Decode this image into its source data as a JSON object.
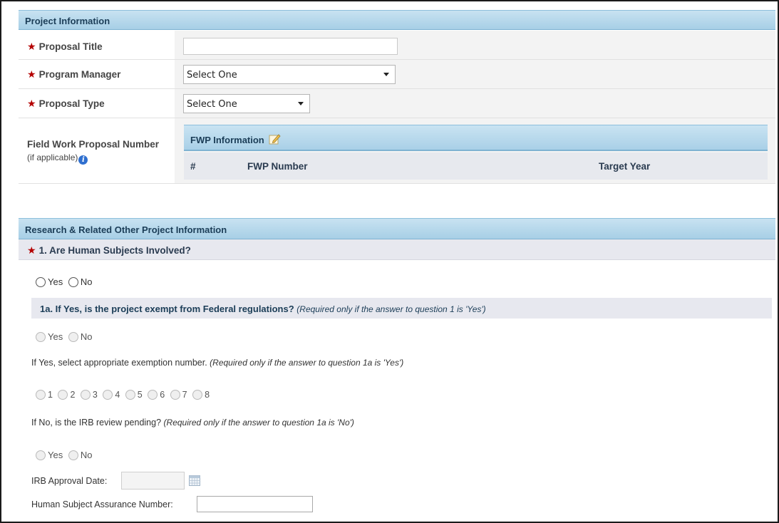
{
  "project_info": {
    "header": "Project Information",
    "proposal_title": {
      "label": "Proposal Title",
      "value": ""
    },
    "program_manager": {
      "label": "Program Manager",
      "selected": "Select One"
    },
    "proposal_type": {
      "label": "Proposal Type",
      "selected": "Select One"
    },
    "fwp": {
      "label": "Field Work Proposal Number",
      "sublabel": "(if applicable)",
      "info_icon": "info-icon",
      "table_header": "FWP Information",
      "edit_icon": "pencil-icon",
      "columns": [
        "#",
        "FWP Number",
        "Target Year"
      ]
    }
  },
  "rr_other": {
    "header": "Research & Related Other Project Information",
    "q1": {
      "label": "1. Are Human Subjects Involved?",
      "options": [
        "Yes",
        "No"
      ]
    },
    "q1a": {
      "label": "1a. If Yes, is the project exempt from Federal regulations?",
      "hint": "(Required only if the answer to question 1 is 'Yes')",
      "options": [
        "Yes",
        "No"
      ]
    },
    "exemption": {
      "label": "If Yes, select appropriate exemption number.",
      "hint": "(Required only if the answer to question 1a is 'Yes')",
      "options": [
        "1",
        "2",
        "3",
        "4",
        "5",
        "6",
        "7",
        "8"
      ]
    },
    "irb_pending": {
      "label": "If No, is the IRB review pending?",
      "hint": "(Required only if the answer to question 1a is 'No')",
      "options": [
        "Yes",
        "No"
      ]
    },
    "irb_approval_date": {
      "label": "IRB Approval Date:",
      "value": "",
      "icon": "calendar-icon"
    },
    "assurance_number": {
      "label": "Human Subject Assurance Number:",
      "value": ""
    }
  },
  "colors": {
    "section_header": "#a7cfe6",
    "required_star": "#b40000",
    "header_text": "#1b3d57"
  }
}
